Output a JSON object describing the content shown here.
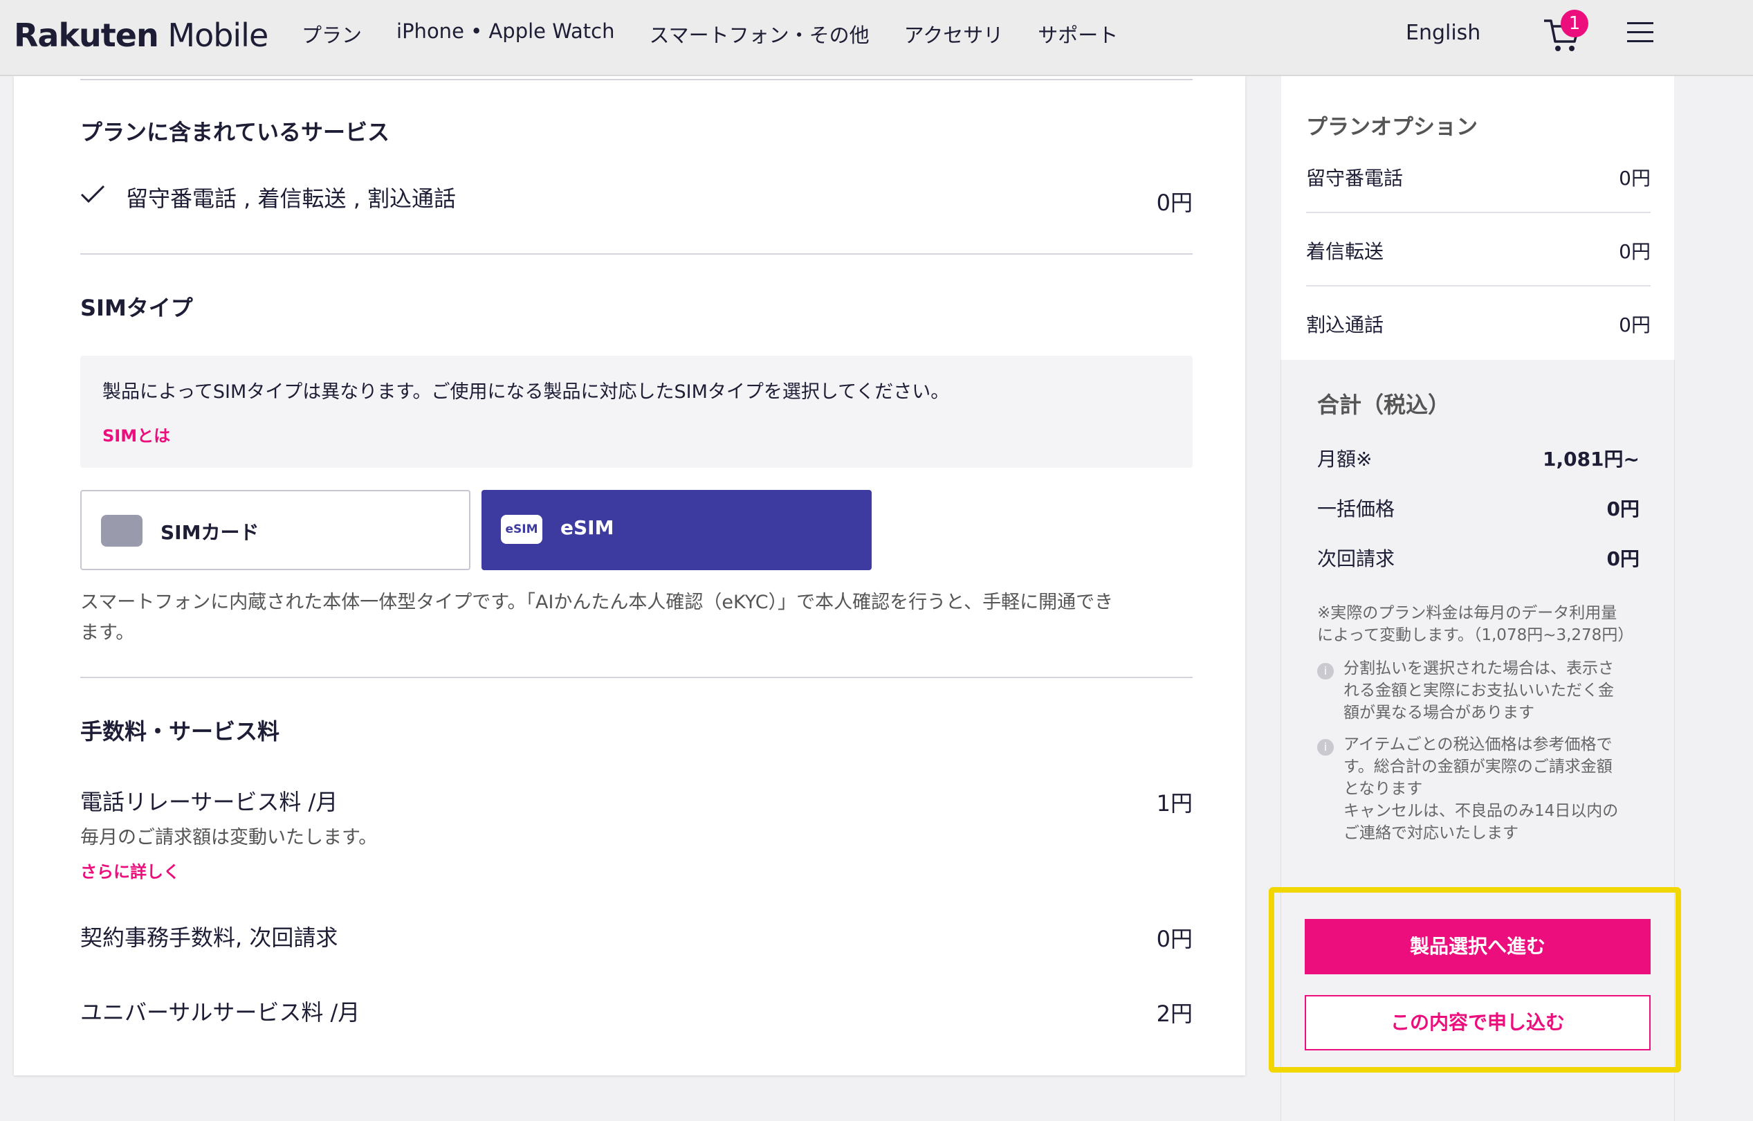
{
  "header": {
    "logo_bold": "Rakuten",
    "logo_thin": "Mobile",
    "nav": [
      "プラン",
      "iPhone • Apple Watch",
      "スマートフォン・その他",
      "アクセサリ",
      "サポート"
    ],
    "language": "English",
    "cart_count": "1"
  },
  "main": {
    "included_title": "プランに含まれているサービス",
    "included_item": "留守番電話 , 着信転送 , 割込通話",
    "included_price": "0円",
    "sim_title": "SIMタイプ",
    "sim_info": "製品によってSIMタイプは異なります。ご使用になる製品に対応したSIMタイプを選択してください。",
    "sim_link": "SIMとは",
    "sim_card_label": "SIMカード",
    "esim_icon_text": "eSIM",
    "esim_label": "eSIM",
    "esim_desc_1": "スマートフォンに内蔵された本体一体型タイプです。「AIかんたん本人確認（eKYC）」で本人確認を行うと、手軽に開通でき",
    "esim_desc_2": "ます。",
    "fees_title": "手数料・サービス料",
    "relay_label": "電話リレーサービス料 /月",
    "relay_price": "1円",
    "relay_note": "毎月のご請求額は変動いたします。",
    "relay_link": "さらに詳しく",
    "contract_label": "契約事務手数料, 次回請求",
    "contract_price": "0円",
    "universal_label": "ユニバーサルサービス料 /月",
    "universal_price": "2円"
  },
  "sidebar": {
    "options_title": "プランオプション",
    "options": [
      {
        "label": "留守番電話",
        "value": "0円"
      },
      {
        "label": "着信転送",
        "value": "0円"
      },
      {
        "label": "割込通話",
        "value": "0円"
      }
    ],
    "total_title": "合計（税込）",
    "totals": [
      {
        "label": "月額※",
        "value": "1,081円~"
      },
      {
        "label": "一括価格",
        "value": "0円"
      },
      {
        "label": "次回請求",
        "value": "0円"
      }
    ],
    "note_1a": "※実際のプラン料金は毎月のデータ利用量",
    "note_1b": "によって変動します。（1,078円~3,278円）",
    "note_2a": "分割払いを選択された場合は、表示さ",
    "note_2b": "れる金額と実際にお支払いいただく金",
    "note_2c": "額が異なる場合があります",
    "note_3a": "アイテムごとの税込価格は参考価格で",
    "note_3b": "す。総合計の金額が実際のご請求金額",
    "note_3c": "となります",
    "note_3d": "キャンセルは、不良品のみ14日以内の",
    "note_3e": "ご連絡で対応いたします",
    "btn_primary": "製品選択へ進む",
    "btn_secondary": "この内容で申し込む"
  }
}
